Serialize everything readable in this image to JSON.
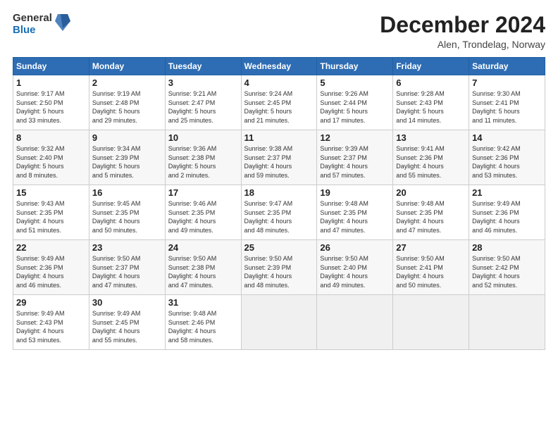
{
  "header": {
    "logo_general": "General",
    "logo_blue": "Blue",
    "month_title": "December 2024",
    "subtitle": "Alen, Trondelag, Norway"
  },
  "weekdays": [
    "Sunday",
    "Monday",
    "Tuesday",
    "Wednesday",
    "Thursday",
    "Friday",
    "Saturday"
  ],
  "weeks": [
    [
      {
        "day": "1",
        "info": "Sunrise: 9:17 AM\nSunset: 2:50 PM\nDaylight: 5 hours\nand 33 minutes."
      },
      {
        "day": "2",
        "info": "Sunrise: 9:19 AM\nSunset: 2:48 PM\nDaylight: 5 hours\nand 29 minutes."
      },
      {
        "day": "3",
        "info": "Sunrise: 9:21 AM\nSunset: 2:47 PM\nDaylight: 5 hours\nand 25 minutes."
      },
      {
        "day": "4",
        "info": "Sunrise: 9:24 AM\nSunset: 2:45 PM\nDaylight: 5 hours\nand 21 minutes."
      },
      {
        "day": "5",
        "info": "Sunrise: 9:26 AM\nSunset: 2:44 PM\nDaylight: 5 hours\nand 17 minutes."
      },
      {
        "day": "6",
        "info": "Sunrise: 9:28 AM\nSunset: 2:43 PM\nDaylight: 5 hours\nand 14 minutes."
      },
      {
        "day": "7",
        "info": "Sunrise: 9:30 AM\nSunset: 2:41 PM\nDaylight: 5 hours\nand 11 minutes."
      }
    ],
    [
      {
        "day": "8",
        "info": "Sunrise: 9:32 AM\nSunset: 2:40 PM\nDaylight: 5 hours\nand 8 minutes."
      },
      {
        "day": "9",
        "info": "Sunrise: 9:34 AM\nSunset: 2:39 PM\nDaylight: 5 hours\nand 5 minutes."
      },
      {
        "day": "10",
        "info": "Sunrise: 9:36 AM\nSunset: 2:38 PM\nDaylight: 5 hours\nand 2 minutes."
      },
      {
        "day": "11",
        "info": "Sunrise: 9:38 AM\nSunset: 2:37 PM\nDaylight: 4 hours\nand 59 minutes."
      },
      {
        "day": "12",
        "info": "Sunrise: 9:39 AM\nSunset: 2:37 PM\nDaylight: 4 hours\nand 57 minutes."
      },
      {
        "day": "13",
        "info": "Sunrise: 9:41 AM\nSunset: 2:36 PM\nDaylight: 4 hours\nand 55 minutes."
      },
      {
        "day": "14",
        "info": "Sunrise: 9:42 AM\nSunset: 2:36 PM\nDaylight: 4 hours\nand 53 minutes."
      }
    ],
    [
      {
        "day": "15",
        "info": "Sunrise: 9:43 AM\nSunset: 2:35 PM\nDaylight: 4 hours\nand 51 minutes."
      },
      {
        "day": "16",
        "info": "Sunrise: 9:45 AM\nSunset: 2:35 PM\nDaylight: 4 hours\nand 50 minutes."
      },
      {
        "day": "17",
        "info": "Sunrise: 9:46 AM\nSunset: 2:35 PM\nDaylight: 4 hours\nand 49 minutes."
      },
      {
        "day": "18",
        "info": "Sunrise: 9:47 AM\nSunset: 2:35 PM\nDaylight: 4 hours\nand 48 minutes."
      },
      {
        "day": "19",
        "info": "Sunrise: 9:48 AM\nSunset: 2:35 PM\nDaylight: 4 hours\nand 47 minutes."
      },
      {
        "day": "20",
        "info": "Sunrise: 9:48 AM\nSunset: 2:35 PM\nDaylight: 4 hours\nand 47 minutes."
      },
      {
        "day": "21",
        "info": "Sunrise: 9:49 AM\nSunset: 2:36 PM\nDaylight: 4 hours\nand 46 minutes."
      }
    ],
    [
      {
        "day": "22",
        "info": "Sunrise: 9:49 AM\nSunset: 2:36 PM\nDaylight: 4 hours\nand 46 minutes."
      },
      {
        "day": "23",
        "info": "Sunrise: 9:50 AM\nSunset: 2:37 PM\nDaylight: 4 hours\nand 47 minutes."
      },
      {
        "day": "24",
        "info": "Sunrise: 9:50 AM\nSunset: 2:38 PM\nDaylight: 4 hours\nand 47 minutes."
      },
      {
        "day": "25",
        "info": "Sunrise: 9:50 AM\nSunset: 2:39 PM\nDaylight: 4 hours\nand 48 minutes."
      },
      {
        "day": "26",
        "info": "Sunrise: 9:50 AM\nSunset: 2:40 PM\nDaylight: 4 hours\nand 49 minutes."
      },
      {
        "day": "27",
        "info": "Sunrise: 9:50 AM\nSunset: 2:41 PM\nDaylight: 4 hours\nand 50 minutes."
      },
      {
        "day": "28",
        "info": "Sunrise: 9:50 AM\nSunset: 2:42 PM\nDaylight: 4 hours\nand 52 minutes."
      }
    ],
    [
      {
        "day": "29",
        "info": "Sunrise: 9:49 AM\nSunset: 2:43 PM\nDaylight: 4 hours\nand 53 minutes."
      },
      {
        "day": "30",
        "info": "Sunrise: 9:49 AM\nSunset: 2:45 PM\nDaylight: 4 hours\nand 55 minutes."
      },
      {
        "day": "31",
        "info": "Sunrise: 9:48 AM\nSunset: 2:46 PM\nDaylight: 4 hours\nand 58 minutes."
      },
      null,
      null,
      null,
      null
    ]
  ]
}
